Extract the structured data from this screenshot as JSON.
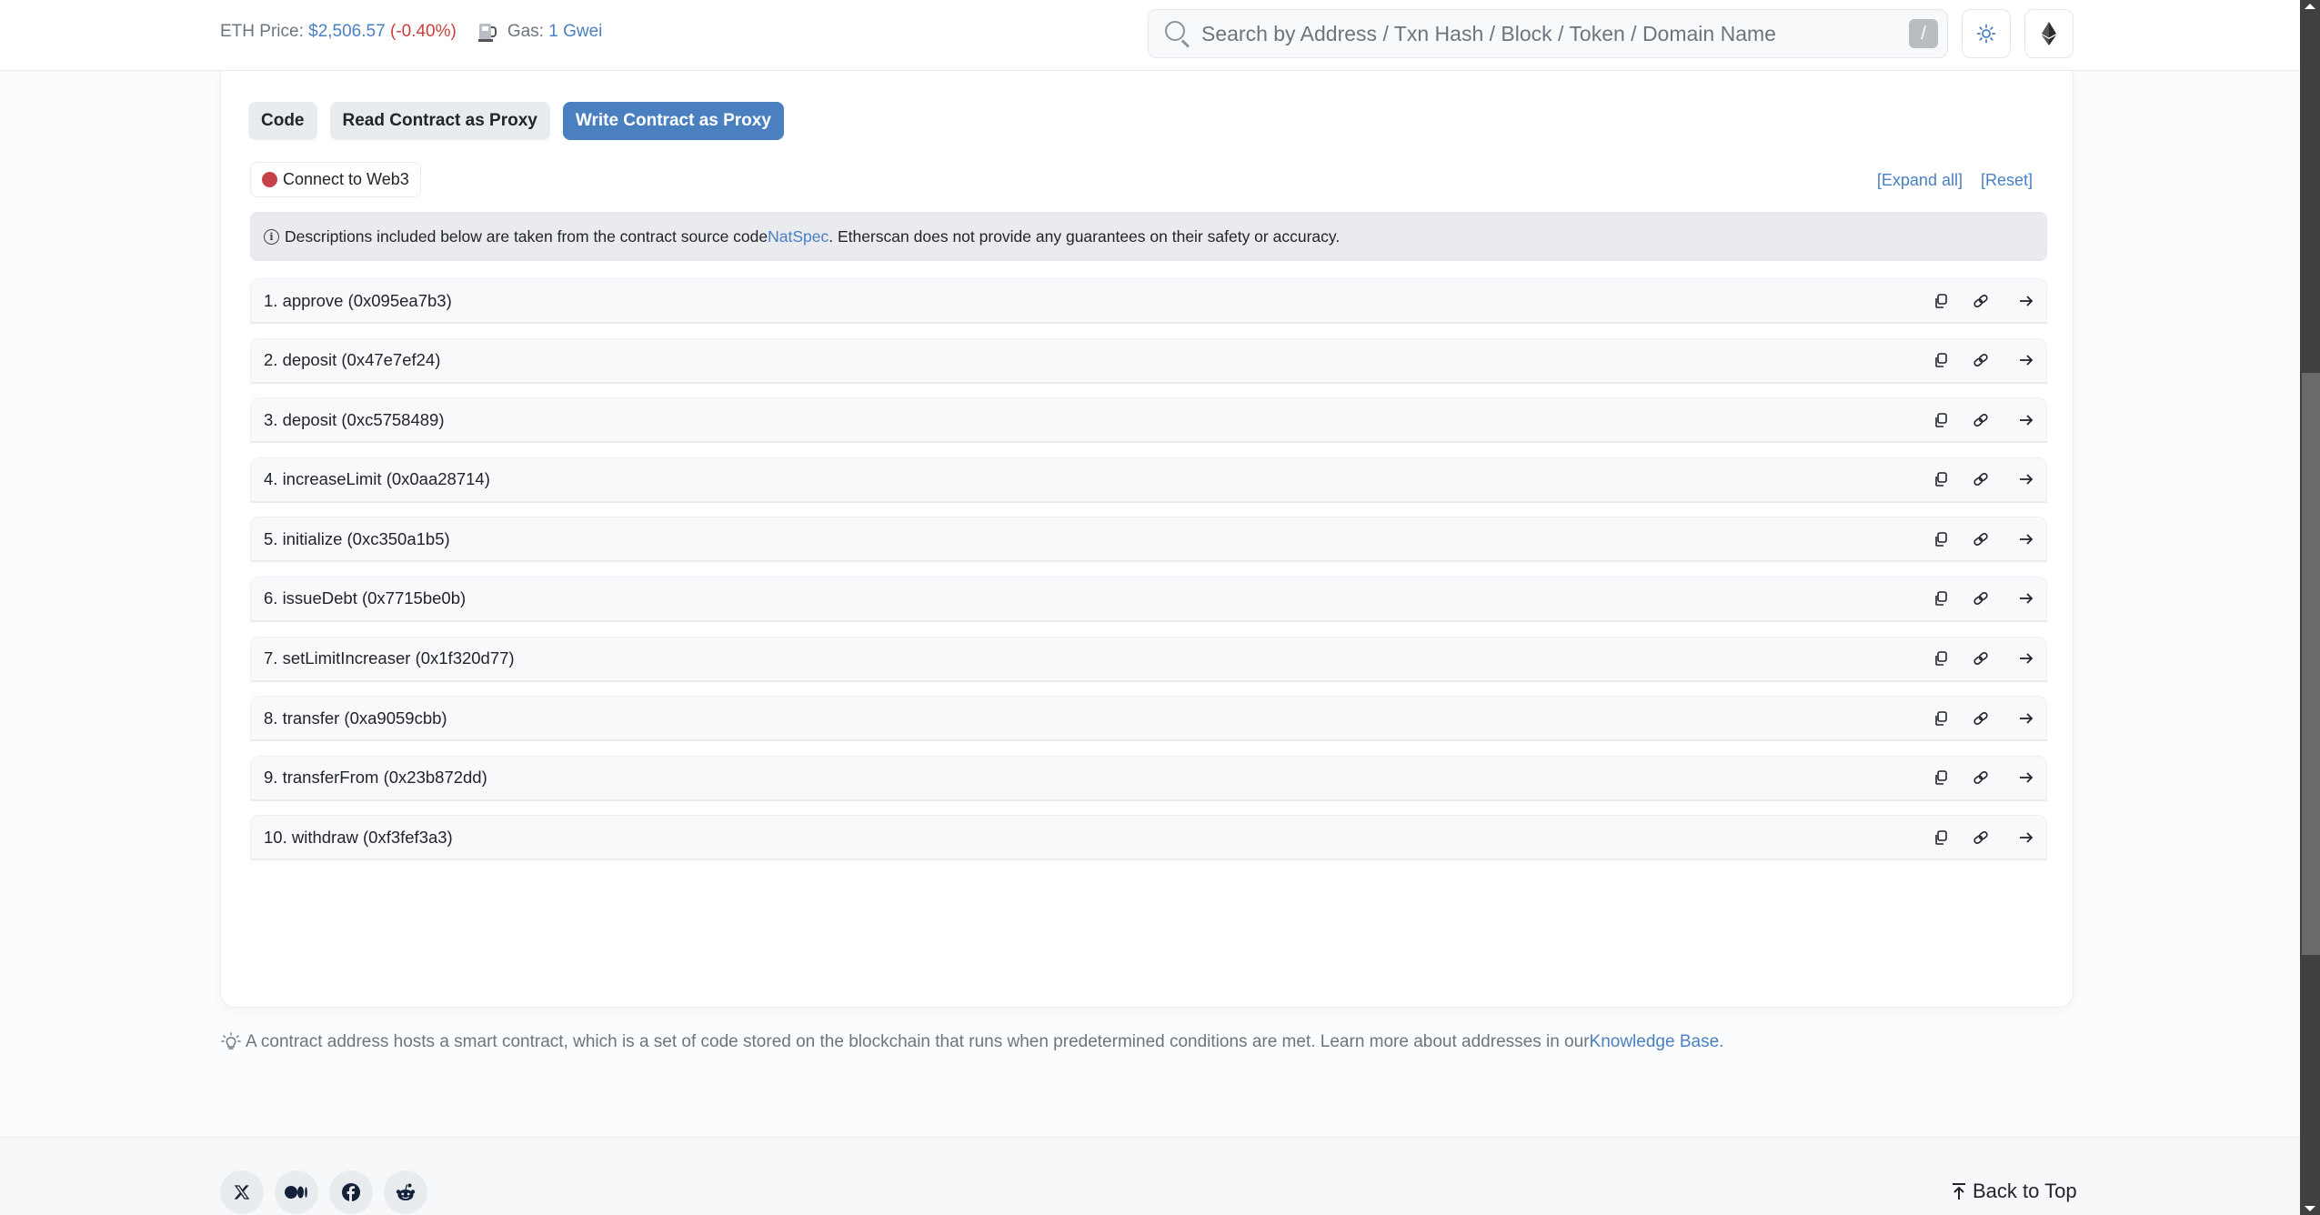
{
  "header": {
    "eth_price_label": "ETH Price:",
    "eth_price_value": "$2,506.57",
    "eth_price_change": "(-0.40%)",
    "gas_label": "Gas:",
    "gas_value": "1 Gwei",
    "search_placeholder": "Search by Address / Txn Hash / Block / Token / Domain Name",
    "search_shortcut": "/",
    "theme_icon": "sun-icon",
    "network_icon": "ethereum-icon"
  },
  "tabs": [
    {
      "label": "Code",
      "active": false
    },
    {
      "label": "Read Contract as Proxy",
      "active": false
    },
    {
      "label": "Write Contract as Proxy",
      "active": true
    }
  ],
  "connect": {
    "label": "Connect to Web3",
    "status_color": "#c5424a"
  },
  "links": {
    "expand_all": "[Expand all]",
    "reset": "[Reset]"
  },
  "info": {
    "text_before": "Descriptions included below are taken from the contract source code ",
    "link": "NatSpec",
    "text_after": ". Etherscan does not provide any guarantees on their safety or accuracy."
  },
  "functions": [
    {
      "label": "1. approve (0x095ea7b3)"
    },
    {
      "label": "2. deposit (0x47e7ef24)"
    },
    {
      "label": "3. deposit (0xc5758489)"
    },
    {
      "label": "4. increaseLimit (0x0aa28714)"
    },
    {
      "label": "5. initialize (0xc350a1b5)"
    },
    {
      "label": "6. issueDebt (0x7715be0b)"
    },
    {
      "label": "7. setLimitIncreaser (0x1f320d77)"
    },
    {
      "label": "8. transfer (0xa9059cbb)"
    },
    {
      "label": "9. transferFrom (0x23b872dd)"
    },
    {
      "label": "10. withdraw (0xf3fef3a3)"
    }
  ],
  "note": {
    "text": "A contract address hosts a smart contract, which is a set of code stored on the blockchain that runs when predetermined conditions are met. Learn more about addresses in our ",
    "link": "Knowledge Base",
    "suffix": "."
  },
  "footer": {
    "social": [
      "x-icon",
      "medium-icon",
      "facebook-icon",
      "reddit-icon"
    ],
    "back_to_top": "Back to Top"
  },
  "colors": {
    "accent": "#4a80c0",
    "link": "#4a7fc1",
    "negative": "#c7403e"
  }
}
